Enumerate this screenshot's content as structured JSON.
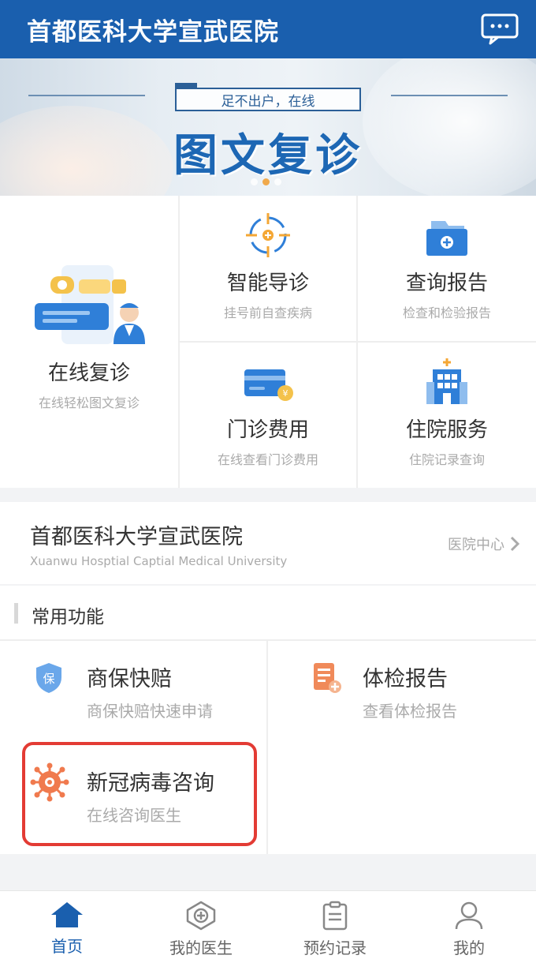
{
  "header": {
    "title": "首都医科大学宣武医院",
    "message_icon": "message-icon"
  },
  "banner": {
    "subtitle": "足不出户，在线",
    "title": "图文复诊",
    "active_dot": 1,
    "dot_count": 3
  },
  "services": {
    "online_revisit": {
      "title": "在线复诊",
      "subtitle": "在线轻松图文复诊",
      "icon": "chat-doctor-icon"
    },
    "smart_guide": {
      "title": "智能导诊",
      "subtitle": "挂号前自查疾病",
      "icon": "crosshair-icon"
    },
    "reports": {
      "title": "查询报告",
      "subtitle": "检查和检验报告",
      "icon": "folder-icon"
    },
    "outpatient_fees": {
      "title": "门诊费用",
      "subtitle": "在线查看门诊费用",
      "icon": "card-icon"
    },
    "inpatient": {
      "title": "住院服务",
      "subtitle": "住院记录查询",
      "icon": "hospital-building-icon"
    }
  },
  "hospital": {
    "name": "首都医科大学宣武医院",
    "english": "Xuanwu Hosptial Captial Medical University",
    "link_label": "医院中心"
  },
  "common": {
    "title": "常用功能",
    "items": [
      {
        "title": "商保快赔",
        "subtitle": "商保快赔快速申请",
        "icon": "shield-icon"
      },
      {
        "title": "体检报告",
        "subtitle": "查看体检报告",
        "icon": "report-icon"
      },
      {
        "title": "新冠病毒咨询",
        "subtitle": "在线咨询医生",
        "icon": "virus-icon"
      }
    ]
  },
  "nav": {
    "items": [
      {
        "label": "首页",
        "icon": "home-icon",
        "active": true
      },
      {
        "label": "我的医生",
        "icon": "doctor-icon",
        "active": false
      },
      {
        "label": "预约记录",
        "icon": "clipboard-icon",
        "active": false
      },
      {
        "label": "我的",
        "icon": "user-icon",
        "active": false
      }
    ]
  },
  "colors": {
    "primary": "#1a5fae",
    "accent_orange": "#f0a94b",
    "highlight_red": "#e33b34"
  }
}
